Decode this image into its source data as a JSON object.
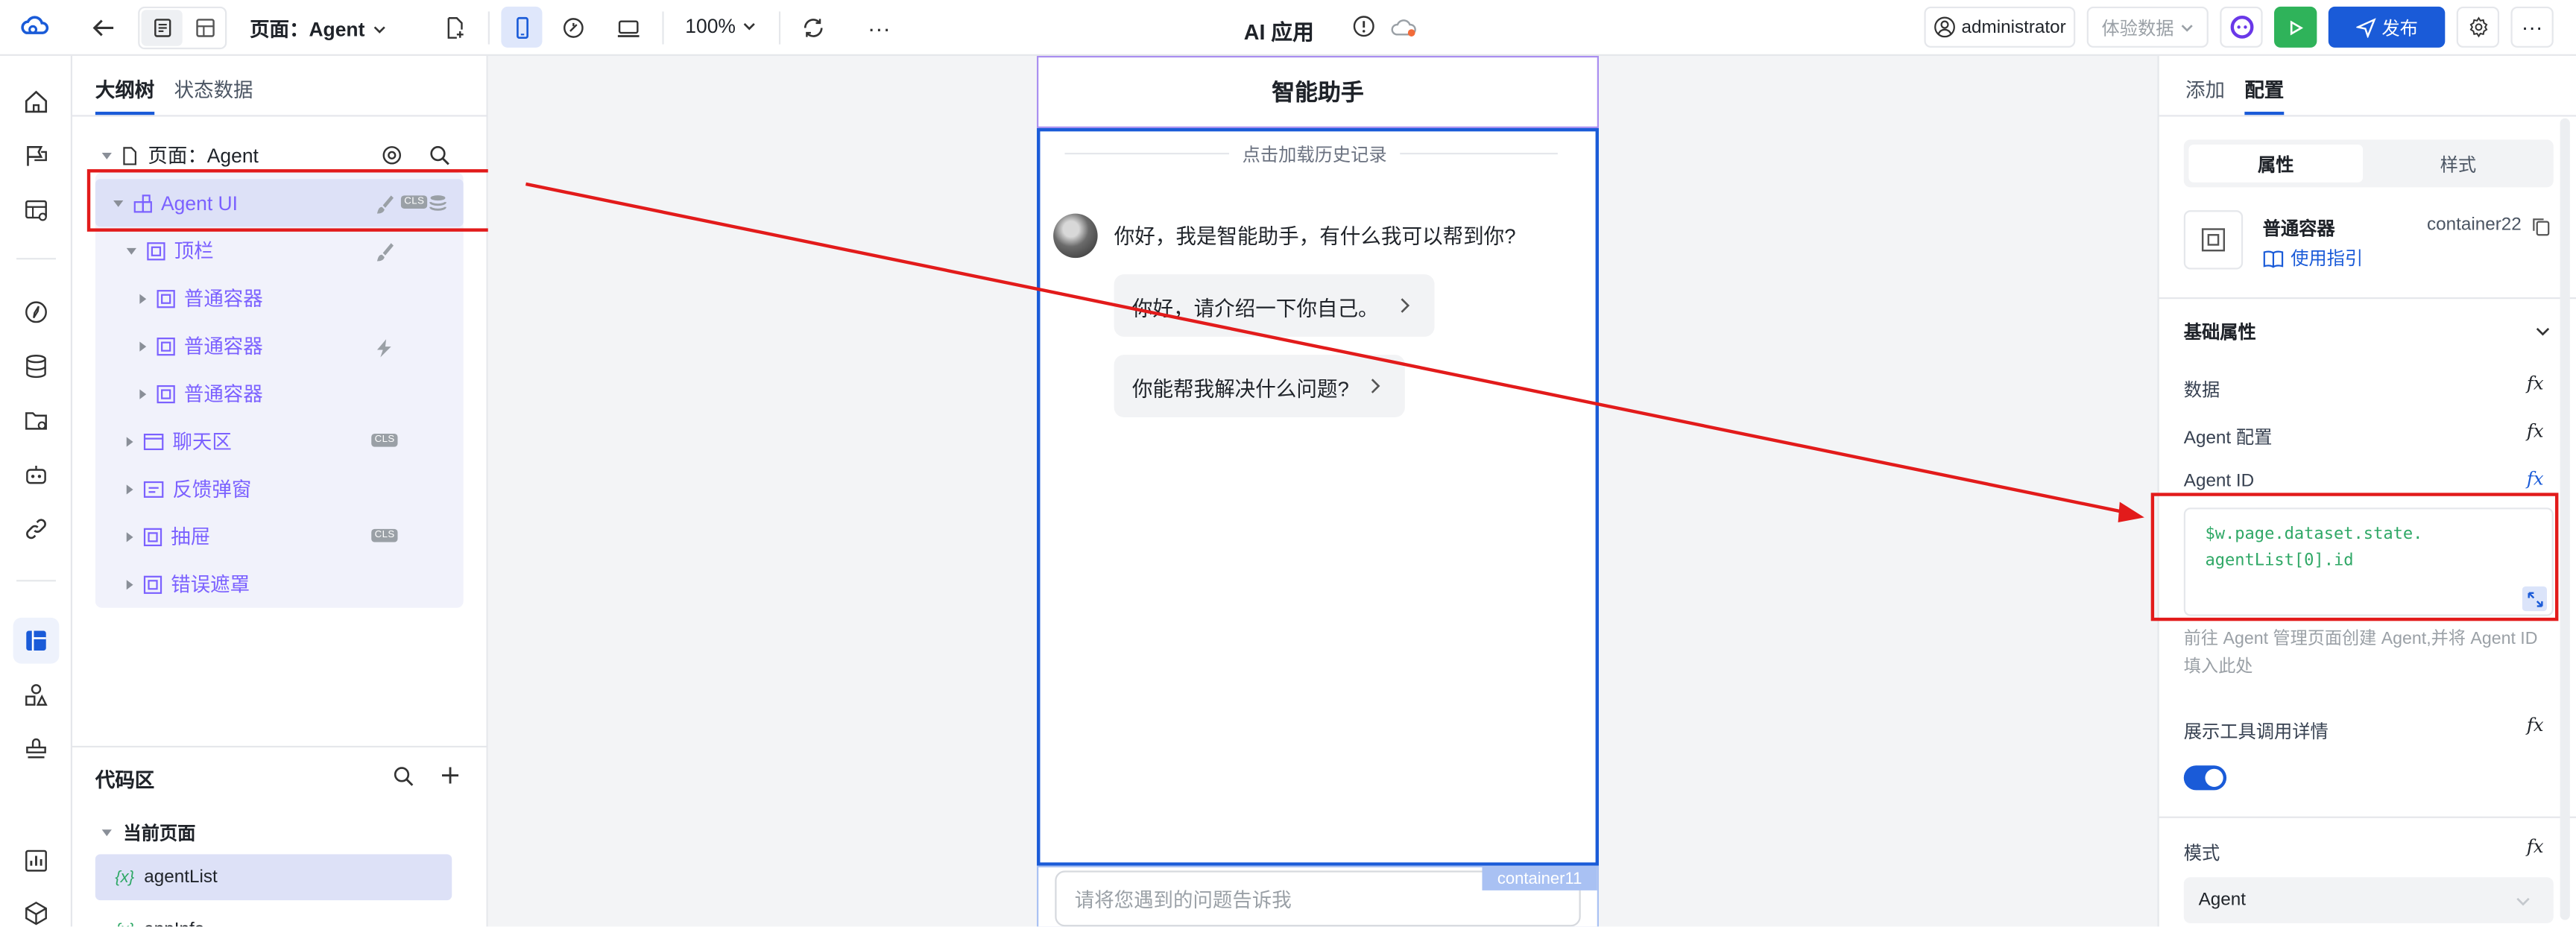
{
  "topbar": {
    "page_label": "页面：Agent",
    "zoom": "100%",
    "app_title": "AI 应用",
    "user": "administrator",
    "experience_data": "体验数据",
    "publish": "发布"
  },
  "left_panel": {
    "tabs": [
      "大纲树",
      "状态数据"
    ],
    "page_node": "页面：Agent",
    "tree": [
      {
        "label": "Agent UI"
      },
      {
        "label": "顶栏"
      },
      {
        "label": "普通容器"
      },
      {
        "label": "普通容器"
      },
      {
        "label": "普通容器"
      },
      {
        "label": "聊天区"
      },
      {
        "label": "反馈弹窗"
      },
      {
        "label": "抽屉"
      },
      {
        "label": "错误遮罩"
      }
    ],
    "badge_text": "CLS",
    "code_area": {
      "title": "代码区",
      "section": "当前页面",
      "items": [
        "agentList",
        "appInfo"
      ],
      "var_symbol": "{x}"
    }
  },
  "canvas": {
    "header_title": "智能助手",
    "history_text": "点击加载历史记录",
    "greeting": "你好，我是智能助手，有什么我可以帮到你?",
    "suggestions": [
      "你好，请介绍一下你自己。",
      "你能帮我解决什么问题?"
    ],
    "input_placeholder": "请将您遇到的问题告诉我",
    "container_label": "container11"
  },
  "right_panel": {
    "tabs": [
      "添加",
      "配置"
    ],
    "subtabs": [
      "属性",
      "样式"
    ],
    "component_name": "普通容器",
    "component_id": "container22",
    "usage_guide": "使用指引",
    "section_title": "基础属性",
    "props": [
      "数据",
      "Agent 配置",
      "Agent ID"
    ],
    "fx_label": "fx",
    "agent_id_code_line1": "$w.page.dataset.state.",
    "agent_id_code_line2": "agentList[0].id",
    "agent_id_hint": "前往 Agent 管理页面创建 Agent,并将 Agent ID 填入此处",
    "tool_detail_label": "展示工具调用详情",
    "mode_label": "模式",
    "mode_value": "Agent"
  },
  "colors": {
    "accent": "#1a5bd8",
    "publish_bg": "#1a5bd8",
    "run_green": "#2fb35a",
    "selection_purple": "#7b61ff",
    "annotation_red": "#e21b1b"
  }
}
